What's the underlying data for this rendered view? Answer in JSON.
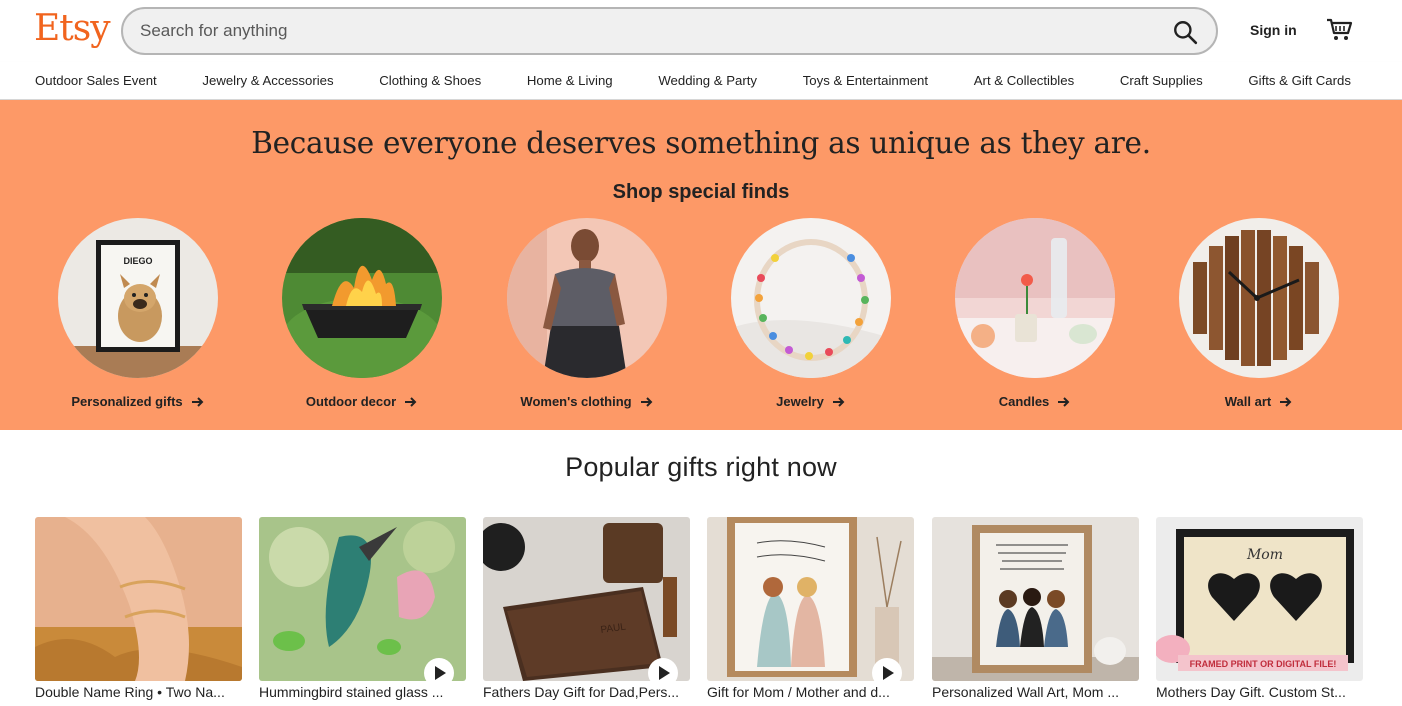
{
  "header": {
    "logo": "Etsy",
    "search_placeholder": "Search for anything",
    "sign_in": "Sign in"
  },
  "nav": {
    "items": [
      "Outdoor Sales Event",
      "Jewelry & Accessories",
      "Clothing & Shoes",
      "Home & Living",
      "Wedding & Party",
      "Toys & Entertainment",
      "Art & Collectibles",
      "Craft Supplies",
      "Gifts & Gift Cards"
    ]
  },
  "hero": {
    "title": "Because everyone deserves something as unique as they are.",
    "subtitle": "Shop special finds",
    "categories": [
      {
        "label": "Personalized gifts"
      },
      {
        "label": "Outdoor decor"
      },
      {
        "label": "Women's clothing"
      },
      {
        "label": "Jewelry"
      },
      {
        "label": "Candles"
      },
      {
        "label": "Wall art"
      }
    ]
  },
  "popular": {
    "title": "Popular gifts right now",
    "items": [
      {
        "title": "Double Name Ring • Two Na..."
      },
      {
        "title": "Hummingbird stained glass ..."
      },
      {
        "title": "Fathers Day Gift for Dad,Pers..."
      },
      {
        "title": "Gift for Mom / Mother and d..."
      },
      {
        "title": "Personalized Wall Art, Mom ..."
      },
      {
        "title": "Mothers Day Gift. Custom St..."
      }
    ],
    "inline_texts": {
      "print_name": "DIEGO",
      "wallet_name": "PAUL",
      "mom_heading": "Mom",
      "banner": "FRAMED PRINT OR DIGITAL FILE!"
    }
  },
  "colors": {
    "brand": "#f1641e",
    "hero_bg": "#fd9967"
  },
  "icons": {
    "search": "search-icon",
    "cart": "cart-icon",
    "arrow": "arrow-right-icon",
    "play": "play-icon"
  }
}
